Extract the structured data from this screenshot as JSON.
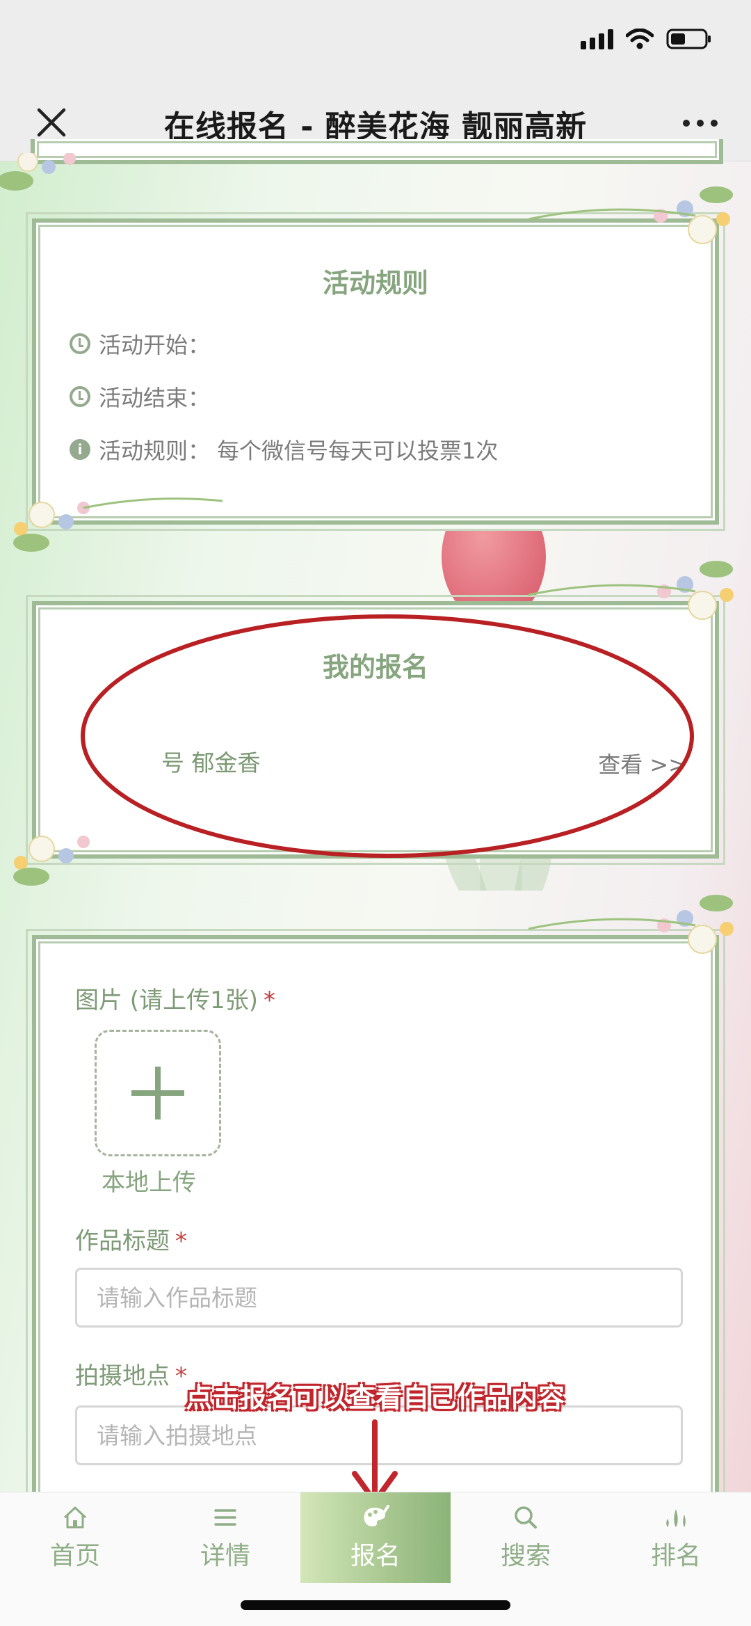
{
  "window": {
    "title": "在线报名 - 醉美花海 靓丽高新"
  },
  "rules_card": {
    "title": "活动规则",
    "start_label": "活动开始：",
    "end_label": "活动结束：",
    "rules_label": "活动规则：",
    "rules_text": "每个微信号每天可以投票1次"
  },
  "my_registration": {
    "title": "我的报名",
    "number_text": "号  郁金香",
    "view_link": "查看 >>"
  },
  "form": {
    "image_label": "图片 (请上传1张)",
    "required_mark": "*",
    "upload_label": "本地上传",
    "title_label": "作品标题",
    "title_placeholder": "请输入作品标题",
    "location_label": "拍摄地点",
    "location_placeholder": "请输入拍摄地点"
  },
  "annotation": {
    "text": "点击报名可以查看自己作品内容"
  },
  "bottom_nav": {
    "items": [
      {
        "label": "首页",
        "icon": "home-icon"
      },
      {
        "label": "详情",
        "icon": "list-icon"
      },
      {
        "label": "报名",
        "icon": "palette-icon",
        "active": true
      },
      {
        "label": "搜索",
        "icon": "search-icon"
      },
      {
        "label": "排名",
        "icon": "ranking-icon"
      }
    ]
  },
  "colors": {
    "accent_green": "#86a57f",
    "annotation_red": "#c0262c",
    "required_red": "#c24242"
  }
}
